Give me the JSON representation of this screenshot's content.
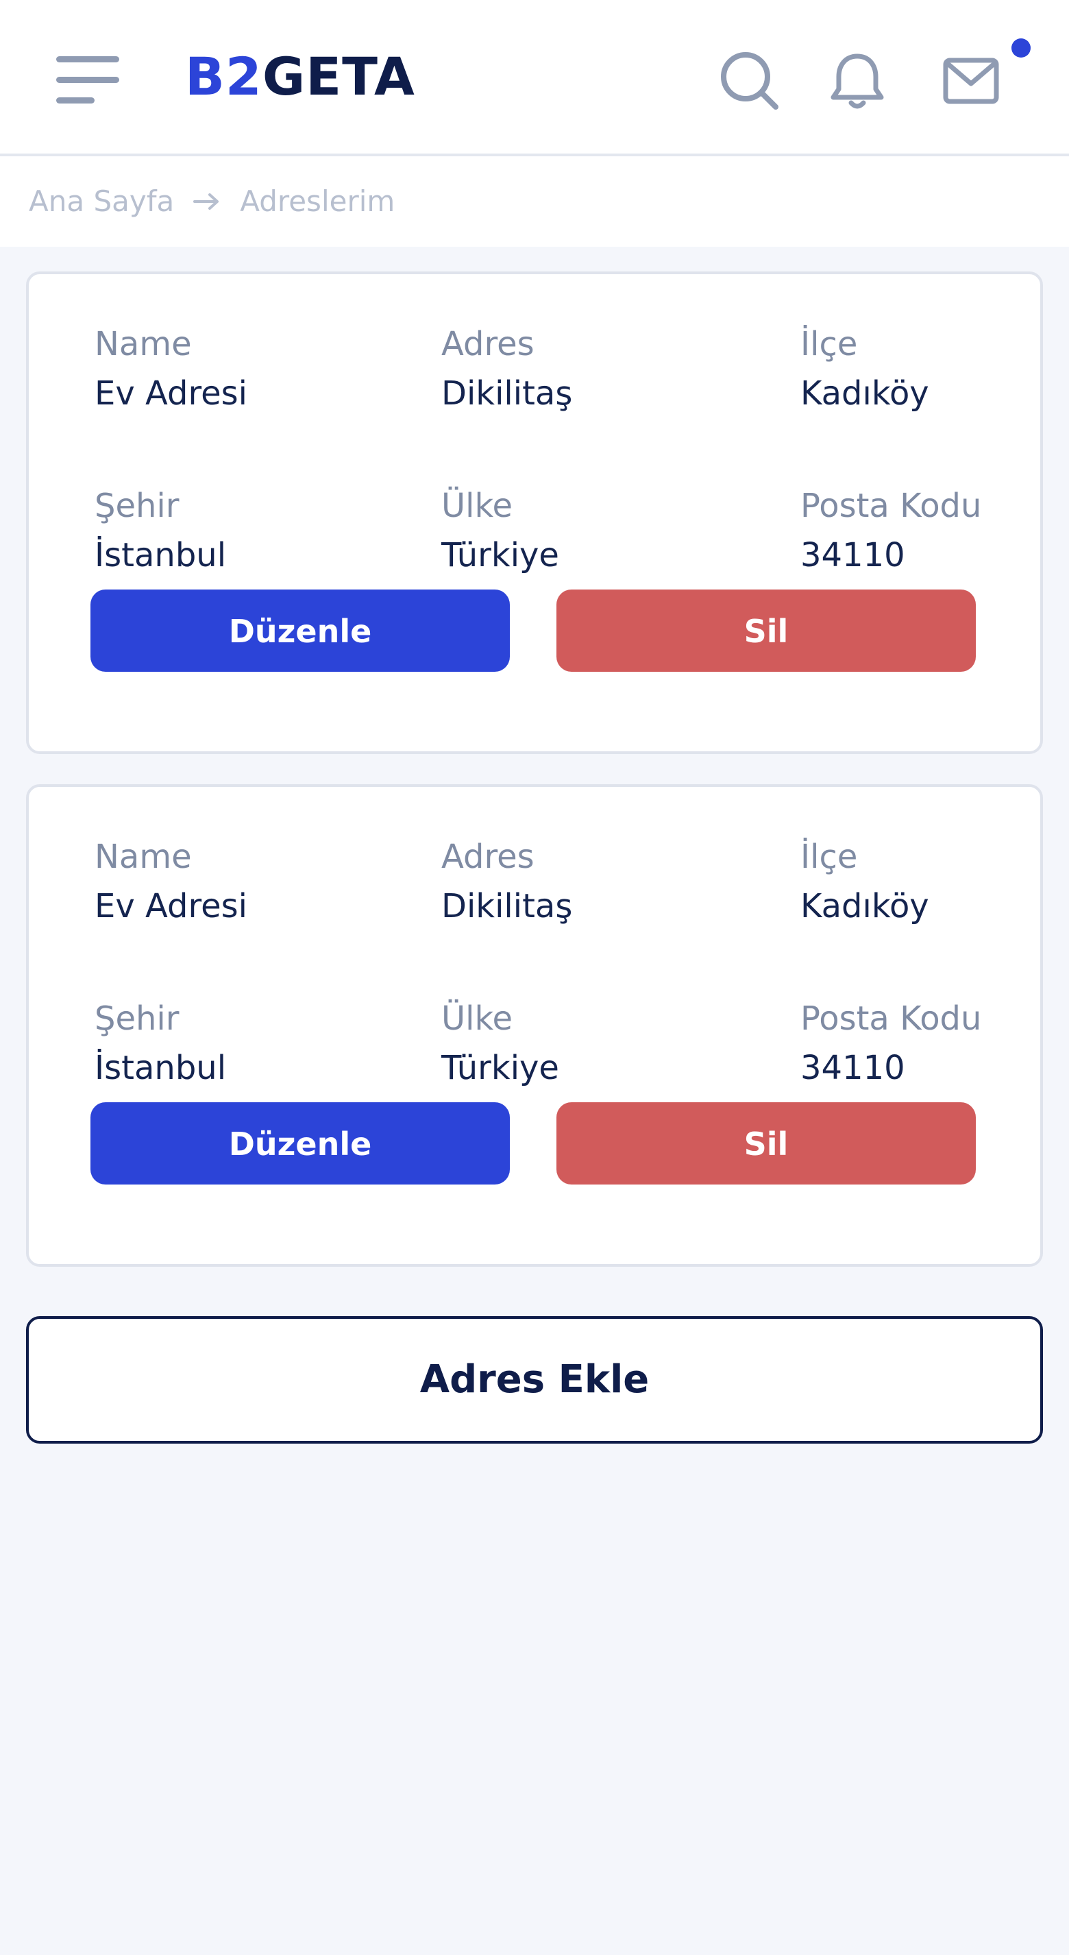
{
  "header": {
    "logo_b": "B2",
    "logo_rest": "GETA",
    "icons": {
      "menu": "menu-icon",
      "search": "search-icon",
      "notifications": "bell-icon",
      "messages": "mail-icon"
    },
    "unread_dot_color": "#2c44d8"
  },
  "breadcrumb": {
    "home": "Ana Sayfa",
    "current": "Adreslerim",
    "separator_icon": "arrow-right-icon"
  },
  "addresses": [
    {
      "name_label": "Name",
      "name": "Ev Adresi",
      "address_label": "Adres",
      "address": "Dikilitaş",
      "district_label": "İlçe",
      "district": "Kadıköy",
      "city_label": "Şehir",
      "city": "İstanbul",
      "country_label": "Ülke",
      "country": "Türkiye",
      "postal_label": "Posta Kodu",
      "postal": "34110",
      "edit_label": "Düzenle",
      "delete_label": "Sil"
    },
    {
      "name_label": "Name",
      "name": "Ev Adresi",
      "address_label": "Adres",
      "address": "Dikilitaş",
      "district_label": "İlçe",
      "district": "Kadıköy",
      "city_label": "Şehir",
      "city": "İstanbul",
      "country_label": "Ülke",
      "country": "Türkiye",
      "postal_label": "Posta Kodu",
      "postal": "34110",
      "edit_label": "Düzenle",
      "delete_label": "Sil"
    }
  ],
  "add_button_label": "Adres Ekle",
  "colors": {
    "primary": "#2c44d8",
    "danger": "#d15b5b",
    "navy": "#0f1d4a",
    "muted": "#7f8ba3",
    "background": "#f4f6fb"
  }
}
